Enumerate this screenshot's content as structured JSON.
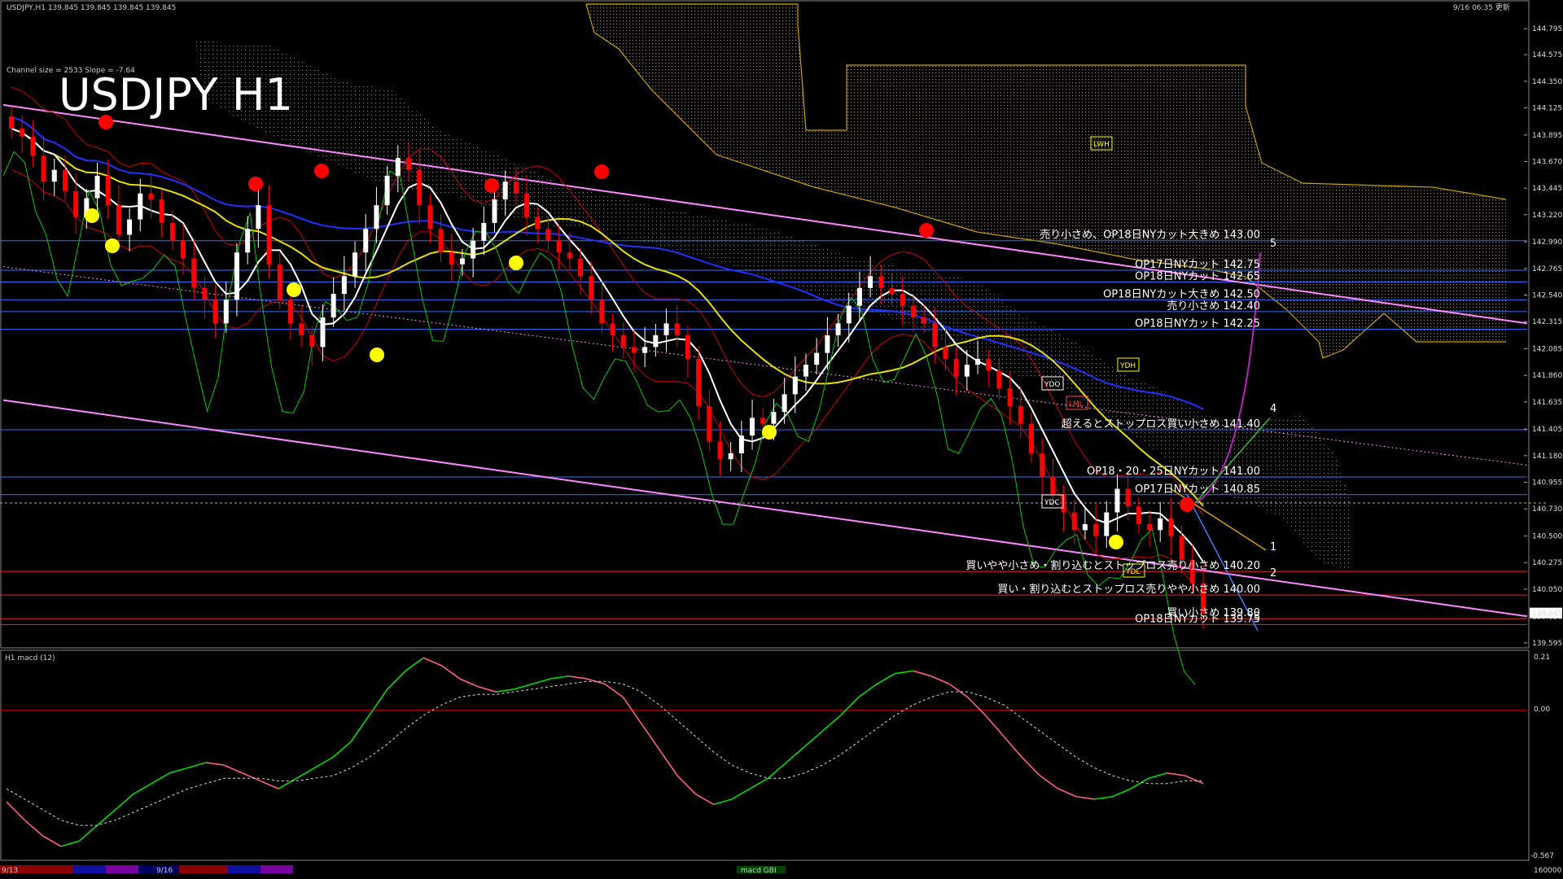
{
  "header": {
    "symbol_line": "USDJPY,H1  139.845 139.845 139.845 139.845",
    "datetime": "9/16 06:35 更新",
    "channel_info": "Channel size = 2533  Slope = -7.64",
    "big_title": "USDJPY H1"
  },
  "macd_panel": {
    "title": "H1  macd (12)",
    "scale_top": "0.21",
    "scale_zero": "0.00",
    "scale_bottom": "-0.567"
  },
  "bottom_bar": {
    "left_date": "9/13",
    "mid_date": "9/16",
    "label": "macd GBI",
    "right_value": "160000"
  },
  "colors": {
    "bg": "#000000",
    "bull": "#ffffff",
    "bear": "#ff0000",
    "kumo": "#ff6a00",
    "kumo_border": "#c8a000",
    "channel": "#ff88ff",
    "level_blue": "#3070ff",
    "level_red": "#ff2020",
    "ma_white": "#ffffff",
    "ma_yellow": "#e8e000",
    "ma_blue": "#2030ff",
    "chikou": "#00cc00",
    "macd": "#00dd00",
    "macd_neg": "#ff6080",
    "signal": "#dddddd"
  },
  "chart_data": {
    "type": "line",
    "symbol": "USDJPY",
    "timeframe": "H1",
    "y_ticks": [
      "144.795",
      "144.575",
      "144.350",
      "144.125",
      "143.895",
      "143.670",
      "143.445",
      "143.220",
      "142.990",
      "142.765",
      "142.540",
      "142.315",
      "142.085",
      "141.860",
      "141.635",
      "141.405",
      "141.180",
      "140.955",
      "140.730",
      "140.500",
      "140.275",
      "140.050",
      "139.820",
      "139.595"
    ],
    "ylim": [
      139.56,
      144.9
    ],
    "current_price": "139.845",
    "close_series": [
      143.95,
      143.88,
      143.72,
      143.5,
      143.6,
      143.42,
      143.2,
      143.36,
      143.55,
      143.3,
      143.05,
      143.18,
      143.4,
      143.35,
      143.15,
      143.0,
      142.85,
      142.6,
      142.5,
      142.3,
      142.5,
      142.9,
      143.1,
      143.3,
      142.8,
      142.5,
      142.3,
      142.2,
      142.1,
      142.35,
      142.55,
      142.7,
      142.9,
      143.1,
      143.3,
      143.55,
      143.7,
      143.6,
      143.3,
      143.1,
      142.9,
      142.8,
      142.85,
      143.0,
      143.15,
      143.35,
      143.5,
      143.4,
      143.2,
      143.1,
      143.0,
      142.9,
      142.85,
      142.7,
      142.5,
      142.3,
      142.2,
      142.1,
      142.05,
      142.1,
      142.2,
      142.3,
      142.2,
      142.0,
      141.6,
      141.3,
      141.15,
      141.2,
      141.35,
      141.5,
      141.45,
      141.55,
      141.7,
      141.85,
      141.95,
      142.05,
      142.2,
      142.3,
      142.45,
      142.6,
      142.7,
      142.6,
      142.55,
      142.45,
      142.35,
      142.3,
      142.1,
      142.0,
      141.85,
      141.95,
      142.0,
      141.9,
      141.75,
      141.6,
      141.45,
      141.2,
      141.0,
      140.85,
      140.7,
      140.55,
      140.6,
      140.5,
      140.7,
      140.9,
      140.75,
      140.6,
      140.55,
      140.65,
      140.5,
      140.3,
      140.1,
      139.85
    ],
    "resistance_levels": [
      {
        "price": 143.0,
        "label": "売り小さめ、OP18日NYカット大きめ 143.00"
      },
      {
        "price": 142.75,
        "label": "OP17日NYカット 142.75"
      },
      {
        "price": 142.65,
        "label": "OP18日NYカット 142.65"
      },
      {
        "price": 142.5,
        "label": "OP18日NYカット大きめ 142.50"
      },
      {
        "price": 142.4,
        "label": "売り小さめ 142.40"
      },
      {
        "price": 142.25,
        "label": "OP18日NYカット 142.25"
      },
      {
        "price": 141.4,
        "label": "超えるとストップロス買い小さめ 141.40"
      },
      {
        "price": 141.0,
        "label": "OP18・20・25日NYカット 141.00"
      },
      {
        "price": 140.85,
        "label": "OP17日NYカット 140.85"
      }
    ],
    "support_levels": [
      {
        "price": 140.2,
        "label": "買いやや小さめ・割り込むとストップロス売り小さめ 140.20"
      },
      {
        "price": 140.0,
        "label": "買い・割り込むとストップロス売りやや小さめ 140.00"
      },
      {
        "price": 139.8,
        "label": "買い小さめ 139.80"
      },
      {
        "price": 139.75,
        "label": "OP18日NYカット 139.75"
      }
    ],
    "markers": [
      "YDO",
      "YDH",
      "YDL",
      "YDC",
      "LML",
      "LWH"
    ],
    "wave_labels": [
      "1",
      "2",
      "3",
      "4",
      "5"
    ],
    "macd_values": [
      -0.35,
      -0.42,
      -0.48,
      -0.52,
      -0.5,
      -0.44,
      -0.38,
      -0.32,
      -0.28,
      -0.24,
      -0.22,
      -0.2,
      -0.21,
      -0.24,
      -0.27,
      -0.3,
      -0.26,
      -0.22,
      -0.18,
      -0.12,
      -0.02,
      0.08,
      0.15,
      0.2,
      0.17,
      0.12,
      0.09,
      0.07,
      0.08,
      0.1,
      0.12,
      0.13,
      0.12,
      0.1,
      0.05,
      -0.05,
      -0.15,
      -0.25,
      -0.32,
      -0.36,
      -0.34,
      -0.3,
      -0.26,
      -0.2,
      -0.14,
      -0.08,
      -0.02,
      0.05,
      0.1,
      0.14,
      0.15,
      0.13,
      0.1,
      0.05,
      -0.02,
      -0.1,
      -0.18,
      -0.25,
      -0.3,
      -0.33,
      -0.34,
      -0.33,
      -0.3,
      -0.26,
      -0.24,
      -0.25,
      -0.28
    ],
    "signal_values": [
      -0.3,
      -0.34,
      -0.38,
      -0.42,
      -0.44,
      -0.44,
      -0.42,
      -0.39,
      -0.36,
      -0.33,
      -0.3,
      -0.28,
      -0.26,
      -0.26,
      -0.26,
      -0.27,
      -0.27,
      -0.26,
      -0.25,
      -0.22,
      -0.18,
      -0.13,
      -0.07,
      -0.02,
      0.02,
      0.05,
      0.06,
      0.06,
      0.07,
      0.08,
      0.09,
      0.1,
      0.11,
      0.11,
      0.1,
      0.07,
      0.02,
      -0.04,
      -0.1,
      -0.16,
      -0.21,
      -0.24,
      -0.26,
      -0.26,
      -0.24,
      -0.21,
      -0.17,
      -0.12,
      -0.07,
      -0.02,
      0.02,
      0.05,
      0.07,
      0.07,
      0.05,
      0.02,
      -0.03,
      -0.08,
      -0.13,
      -0.18,
      -0.22,
      -0.25,
      -0.27,
      -0.28,
      -0.28,
      -0.27,
      -0.27
    ]
  }
}
